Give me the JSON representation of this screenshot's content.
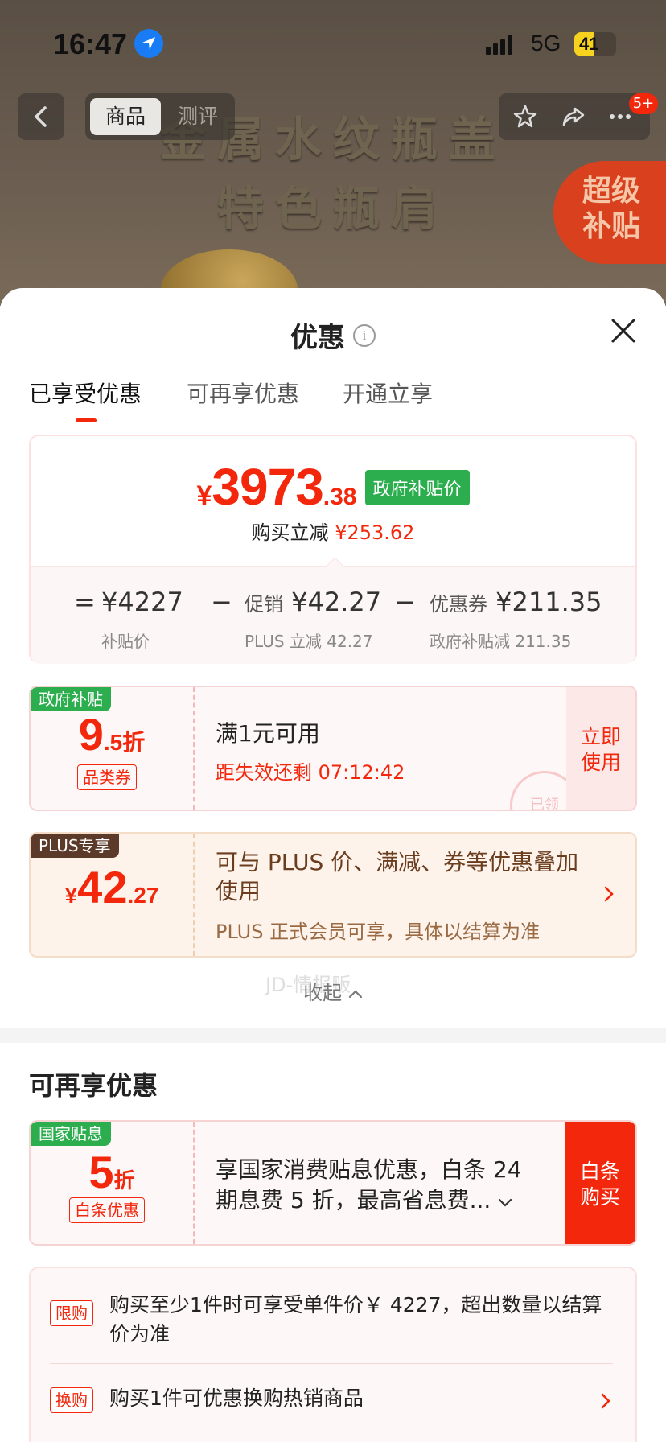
{
  "status": {
    "time": "16:47",
    "network": "5G",
    "battery": "41"
  },
  "header": {
    "seg_product": "商品",
    "seg_review": "测评",
    "cart_badge": "5+",
    "subsidy_banner": "超级\n补贴",
    "headline_line1": "金属水纹瓶盖",
    "headline_line2": "特色瓶肩"
  },
  "sheet": {
    "title": "优惠",
    "tabs": [
      "已享受优惠",
      "可再享优惠",
      "开通立享"
    ],
    "price": {
      "yen": "¥",
      "integer": "3973",
      "decimal": ".38",
      "tag": "政府补贴价",
      "reduce_label": "购买立减",
      "reduce_amount": "¥253.62"
    },
    "breakdown": {
      "eq": "=",
      "base": "¥4227",
      "base_sub": "补贴价",
      "minus1": "−",
      "promo_label": "促销",
      "promo": "¥42.27",
      "promo_sub": "PLUS 立减 42.27",
      "minus2": "−",
      "coupon_label": "优惠券",
      "coupon": "¥211.35",
      "coupon_sub": "政府补贴减 211.35"
    },
    "coupon_gov": {
      "tag": "政府补贴",
      "big": "9",
      "small": ".5折",
      "type": "品类券",
      "line1": "满1元可用",
      "line2": "距失效还剩 07:12:42",
      "button": "立即\n使用",
      "stamp": "已领"
    },
    "coupon_plus": {
      "tag": "PLUS专享",
      "yen": "¥",
      "big": "42",
      "small": ".27",
      "line1": "可与 PLUS 价、满减、券等优惠叠加使用",
      "line2": "PLUS 正式会员可享，具体以结算为准"
    },
    "collapse": "收起",
    "watermark": "JD-情报贩",
    "more_title": "可再享优惠",
    "coupon_baitiao": {
      "tag": "国家贴息",
      "big": "5",
      "small": "折",
      "type": "白条优惠",
      "line1": "享国家消费贴息优惠，白条 24",
      "line2": "期息费 5 折，最高省息费...",
      "button": "白条\n购买"
    },
    "list": [
      {
        "tag": "限购",
        "text": "购买至少1件时可享受单件价￥ 4227，超出数量以结算价为准"
      },
      {
        "tag": "换购",
        "text": "购买1件可优惠换购热销商品"
      }
    ]
  },
  "colors": {
    "accent": "#f2270c",
    "green": "#2cae4e"
  }
}
